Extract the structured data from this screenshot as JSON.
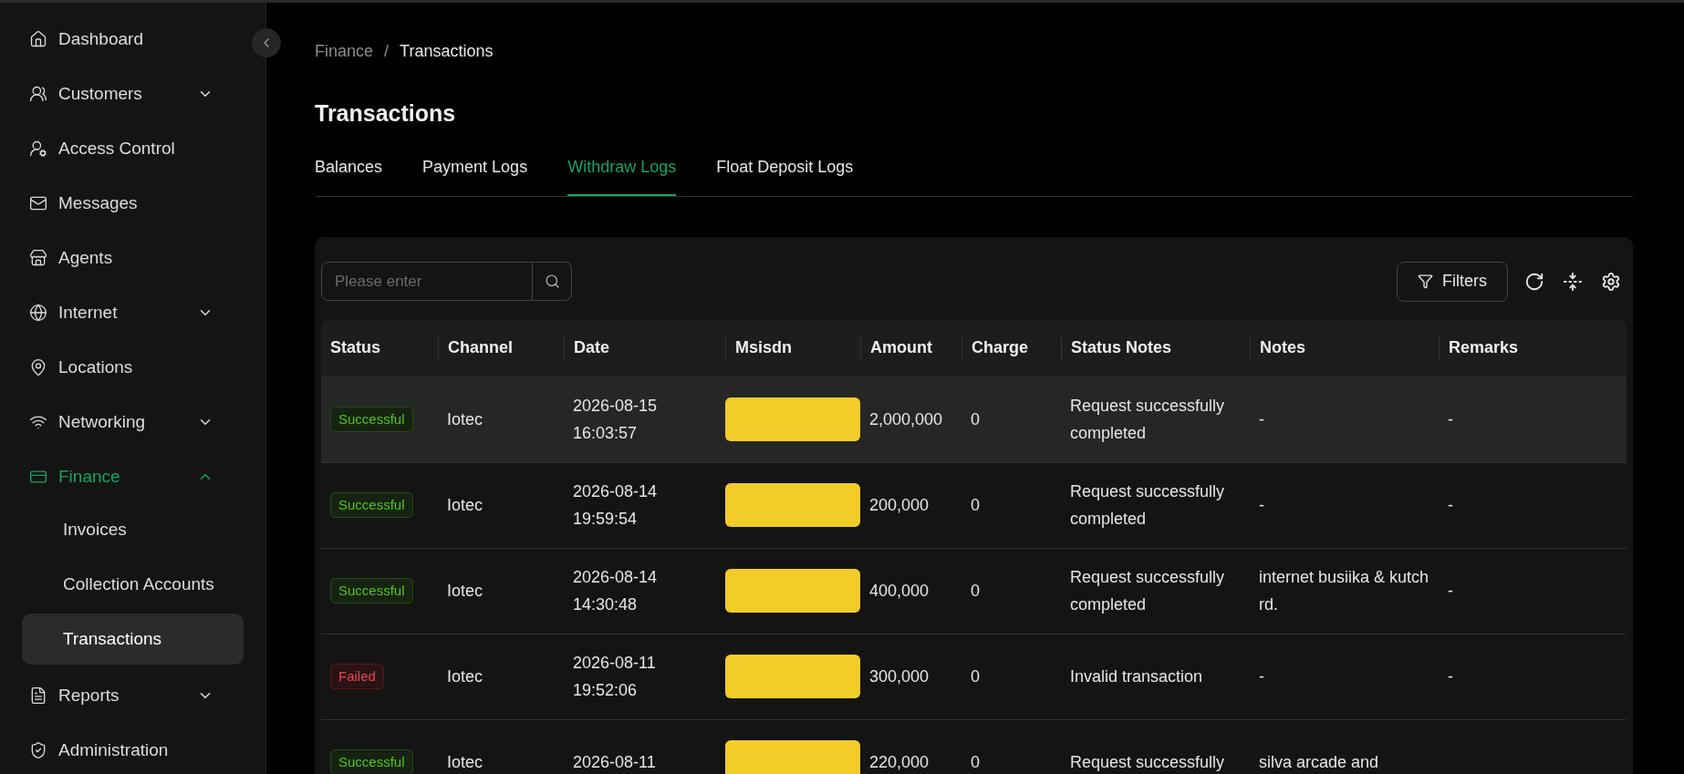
{
  "sidebar": {
    "items": [
      {
        "label": "Dashboard",
        "selected": false
      },
      {
        "label": "Customers",
        "selected": false,
        "expanded": false
      },
      {
        "label": "Access Control",
        "selected": false
      },
      {
        "label": "Messages",
        "selected": false
      },
      {
        "label": "Agents",
        "selected": false
      },
      {
        "label": "Internet",
        "selected": false,
        "expanded": false
      },
      {
        "label": "Locations",
        "selected": false
      },
      {
        "label": "Networking",
        "selected": false,
        "expanded": false
      },
      {
        "label": "Finance",
        "selected": true,
        "expanded": true,
        "children": [
          {
            "label": "Invoices",
            "selected": false
          },
          {
            "label": "Collection Accounts",
            "selected": false
          },
          {
            "label": "Transactions",
            "selected": true
          }
        ]
      },
      {
        "label": "Reports",
        "selected": false,
        "expanded": false
      },
      {
        "label": "Administration",
        "selected": false
      }
    ]
  },
  "breadcrumb": {
    "items": [
      "Finance",
      "Transactions"
    ],
    "separator": "/"
  },
  "page_title": "Transactions",
  "tabs": [
    {
      "label": "Balances",
      "selected": false
    },
    {
      "label": "Payment Logs",
      "selected": false
    },
    {
      "label": "Withdraw Logs",
      "selected": true
    },
    {
      "label": "Float Deposit Logs",
      "selected": false
    }
  ],
  "search": {
    "placeholder": "Please enter"
  },
  "filters_button": "Filters",
  "table": {
    "columns": [
      "Status",
      "Channel",
      "Date",
      "Msisdn",
      "Amount",
      "Charge",
      "Status Notes",
      "Notes",
      "Remarks"
    ],
    "rows": [
      {
        "highlighted": true,
        "status": {
          "label": "Successful",
          "kind": "success"
        },
        "channel": "Iotec",
        "date": [
          "2026-08-15",
          "16:03:57"
        ],
        "msisdn_redacted": true,
        "amount": "2,000,000",
        "charge": "0",
        "status_notes": "Request successfully completed",
        "notes": "-",
        "remarks": "-"
      },
      {
        "highlighted": false,
        "status": {
          "label": "Successful",
          "kind": "success"
        },
        "channel": "Iotec",
        "date": [
          "2026-08-14",
          "19:59:54"
        ],
        "msisdn_redacted": true,
        "amount": "200,000",
        "charge": "0",
        "status_notes": "Request successfully completed",
        "notes": "-",
        "remarks": "-"
      },
      {
        "highlighted": false,
        "status": {
          "label": "Successful",
          "kind": "success"
        },
        "channel": "Iotec",
        "date": [
          "2026-08-14",
          "14:30:48"
        ],
        "msisdn_redacted": true,
        "amount": "400,000",
        "charge": "0",
        "status_notes": "Request successfully completed",
        "notes": "internet busiika & kutch rd.",
        "remarks": "-"
      },
      {
        "highlighted": false,
        "status": {
          "label": "Failed",
          "kind": "failed"
        },
        "channel": "Iotec",
        "date": [
          "2026-08-11",
          "19:52:06"
        ],
        "msisdn_redacted": true,
        "amount": "300,000",
        "charge": "0",
        "status_notes": "Invalid transaction",
        "notes": "-",
        "remarks": "-"
      },
      {
        "highlighted": false,
        "status": {
          "label": "Successful",
          "kind": "success"
        },
        "channel": "Iotec",
        "date": [
          "2026-08-11"
        ],
        "msisdn_redacted": true,
        "amount": "220,000",
        "charge": "0",
        "status_notes": "Request successfully",
        "notes": "silva arcade and",
        "remarks": ""
      }
    ]
  }
}
